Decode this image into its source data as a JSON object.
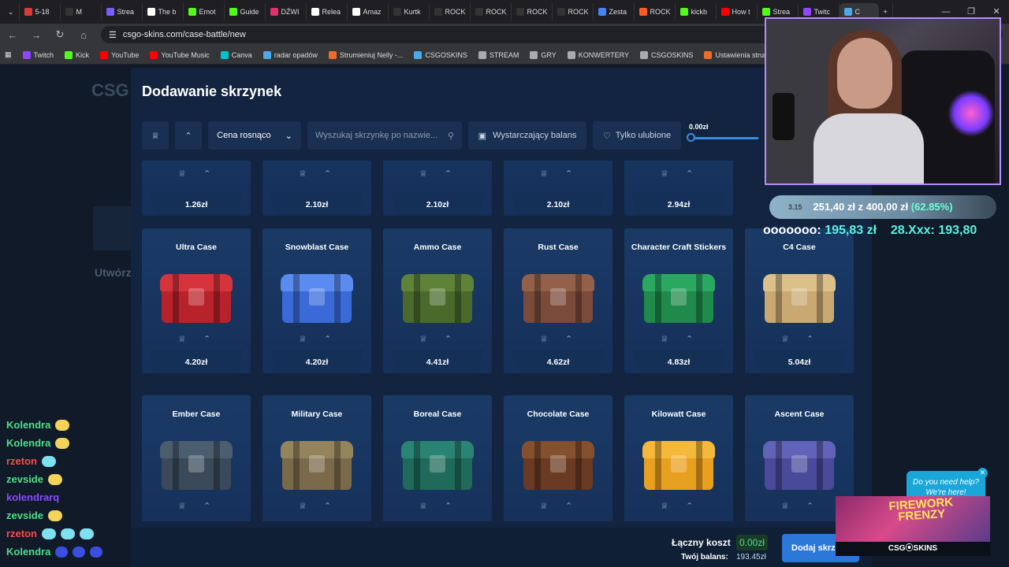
{
  "browser": {
    "tabs": [
      "5-18",
      "M",
      "Strea",
      "The b",
      "Emot",
      "Guide",
      "DŹWI",
      "Relea",
      "Amaz",
      "Kurtk",
      "ROCK",
      "ROCK",
      "ROCK",
      "ROCK",
      "Zesta",
      "ROCK",
      "kickb",
      "How t",
      "Strea",
      "Twitc",
      "C"
    ],
    "tab_colors": [
      "#d83a3a",
      "#333",
      "#7b5cff",
      "#fff",
      "#53fc18",
      "#53fc18",
      "#e1306c",
      "#fff",
      "#fff",
      "#333",
      "#333",
      "#333",
      "#333",
      "#333",
      "#4285f4",
      "#ff5a1f",
      "#53fc18",
      "#ff0000",
      "#53fc18",
      "#9146ff",
      "#4fa8e8"
    ],
    "url": "csgo-skins.com/case-battle/new",
    "bookmarks": [
      {
        "label": "Twitch",
        "color": "#9146ff"
      },
      {
        "label": "Kick",
        "color": "#53fc18"
      },
      {
        "label": "YouTube",
        "color": "#ff0000"
      },
      {
        "label": "YouTube Music",
        "color": "#ff0000"
      },
      {
        "label": "Canva",
        "color": "#00c4cc"
      },
      {
        "label": "radar opadów",
        "color": "#4fa8e8"
      },
      {
        "label": "Strumieniuj Nelly -...",
        "color": "#f06a2a"
      },
      {
        "label": "CSGOSKINS",
        "color": "#4fa8e8"
      },
      {
        "label": "STREAM",
        "color": "#aaa"
      },
      {
        "label": "GRY",
        "color": "#aaa"
      },
      {
        "label": "KONWERTERY",
        "color": "#aaa"
      },
      {
        "label": "CSGOSKINS",
        "color": "#aaa"
      },
      {
        "label": "Ustawienia strumien...",
        "color": "#f06a2a"
      },
      {
        "label": "MCHOSE HUE",
        "color": "#ddd"
      }
    ]
  },
  "site": {
    "logo": "CSG",
    "heading": "Utwórz"
  },
  "modal": {
    "title": "Dodawanie skrzynek",
    "sort_label": "Cena rosnąco",
    "search_placeholder": "Wyszukaj skrzynkę po nazwie...",
    "balance_filter": "Wystarczający balans",
    "favorites_filter": "Tylko ulubione",
    "slider_value": "0.00zł",
    "top_row_prices": [
      "1.26zł",
      "2.10zł",
      "2.10zł",
      "2.10zł",
      "2.94zł"
    ],
    "cases": [
      {
        "name": "Ultra Case",
        "price": "4.20zł",
        "color": "#b8222a",
        "lid": "#d6343c"
      },
      {
        "name": "Snowblast Case",
        "price": "4.20zł",
        "color": "#3a6ad8",
        "lid": "#5a8cf0"
      },
      {
        "name": "Ammo Case",
        "price": "4.41zł",
        "color": "#4a6a2c",
        "lid": "#5e8238"
      },
      {
        "name": "Rust Case",
        "price": "4.62zł",
        "color": "#7a4a3a",
        "lid": "#94604a"
      },
      {
        "name": "Character Craft Stickers",
        "price": "4.83zł",
        "color": "#1f8a4a",
        "lid": "#2aa860"
      },
      {
        "name": "C4 Case",
        "price": "5.04zł",
        "color": "#c9a872",
        "lid": "#dcc08a"
      },
      {
        "name": "Ember Case",
        "price": "",
        "color": "#3a4a5a",
        "lid": "#4a5e70"
      },
      {
        "name": "Military Case",
        "price": "",
        "color": "#7a6a4a",
        "lid": "#94845c"
      },
      {
        "name": "Boreal Case",
        "price": "",
        "color": "#1f6a5a",
        "lid": "#2a8474"
      },
      {
        "name": "Chocolate Case",
        "price": "",
        "color": "#6a3a22",
        "lid": "#84502e"
      },
      {
        "name": "Kilowatt Case",
        "price": "",
        "color": "#e8a020",
        "lid": "#f4b83a"
      },
      {
        "name": "Ascent Case",
        "price": "",
        "color": "#4a4a9a",
        "lid": "#6262b8"
      }
    ],
    "total_label": "Łączny koszt",
    "total_value": "0.00zł",
    "balance_label": "Twój balans:",
    "balance_value": "193.45zł",
    "add_button": "Dodaj skrz"
  },
  "overlay": {
    "goal_text": "251,40 zł z 400,00 zł",
    "goal_pct": "(62.85%)",
    "goal_ghost": "3.15",
    "bet_a_name": "ooooooo:",
    "bet_a_value": "195,83 zł",
    "bet_b_name": "28.Xxx:",
    "bet_b_value": "193,80"
  },
  "chat": [
    {
      "user": "Kolendra",
      "color": "#4ce08a",
      "emotes": [
        "yellow"
      ]
    },
    {
      "user": "Kolendra",
      "color": "#4ce08a",
      "emotes": [
        "yellow"
      ]
    },
    {
      "user": "rzeton",
      "color": "#ff4a4a",
      "emotes": [
        "blue"
      ]
    },
    {
      "user": "zevside",
      "color": "#4ce08a",
      "emotes": [
        "yellow"
      ]
    },
    {
      "user": "kolendrarq",
      "color": "#8a4aff",
      "emotes": []
    },
    {
      "user": "zevside",
      "color": "#4ce08a",
      "emotes": [
        "yellow"
      ]
    },
    {
      "user": "rzeton",
      "color": "#ff4a4a",
      "emotes": [
        "blue",
        "blue",
        "blue"
      ]
    },
    {
      "user": "Kolendra",
      "color": "#4ce08a",
      "emotes": [
        "navy",
        "navy",
        "navy"
      ]
    }
  ],
  "help": {
    "line1": "Do you need help?",
    "line2": "We're here!"
  },
  "ad": {
    "title_1": "FIREWORK",
    "title_2": "FRENZY",
    "brand": "CSG⦿SKINS"
  }
}
